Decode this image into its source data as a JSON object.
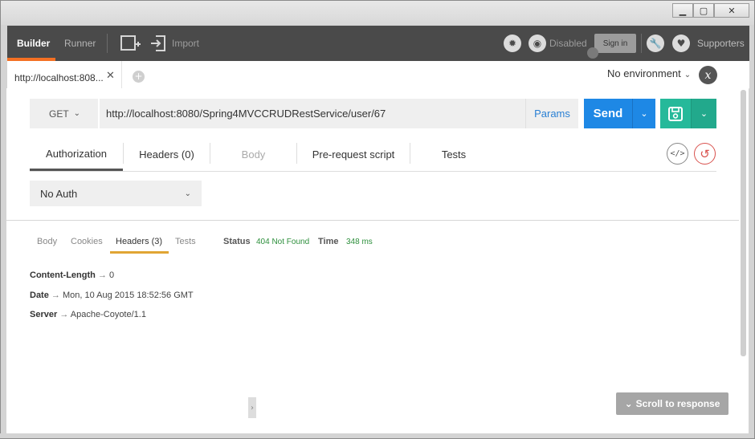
{
  "window": {
    "minimize": "▁",
    "maximize": "▢",
    "close": "✕"
  },
  "appbar": {
    "builder": "Builder",
    "runner": "Runner",
    "import": "Import",
    "sync_label": "Disabled",
    "signin": "Sign in",
    "supporters": "Supporters"
  },
  "tabs": {
    "current": "http://localhost:808...",
    "close": "✕",
    "add": "+",
    "environment": "No environment",
    "env_chevron": "⌄",
    "env_icon": "x"
  },
  "request": {
    "method": "GET",
    "url": "http://localhost:8080/Spring4MVCCRUDRestService/user/67",
    "params": "Params",
    "send": "Send"
  },
  "request_tabs": [
    {
      "label": "Authorization"
    },
    {
      "label": "Headers (0)"
    },
    {
      "label": "Body"
    },
    {
      "label": "Pre-request script"
    },
    {
      "label": "Tests"
    }
  ],
  "auth": {
    "value": "No Auth"
  },
  "response": {
    "tabs": [
      {
        "label": "Body"
      },
      {
        "label": "Cookies"
      },
      {
        "label": "Headers (3)"
      },
      {
        "label": "Tests"
      }
    ],
    "status_label": "Status",
    "status_value": "404 Not Found",
    "time_label": "Time",
    "time_value": "348 ms",
    "headers": [
      {
        "key": "Content-Length",
        "value": "0"
      },
      {
        "key": "Date",
        "value": "Mon, 10 Aug 2015 18:52:56 GMT"
      },
      {
        "key": "Server",
        "value": "Apache-Coyote/1.1"
      }
    ],
    "arrow": "→"
  },
  "scroll_to_response": "Scroll to response",
  "colors": {
    "accent": "#f47023",
    "send": "#1e88e5",
    "save": "#26b99a",
    "status_ok": "#2d8f3c",
    "tab_underline": "#e0a534",
    "reset": "#d9534f"
  }
}
